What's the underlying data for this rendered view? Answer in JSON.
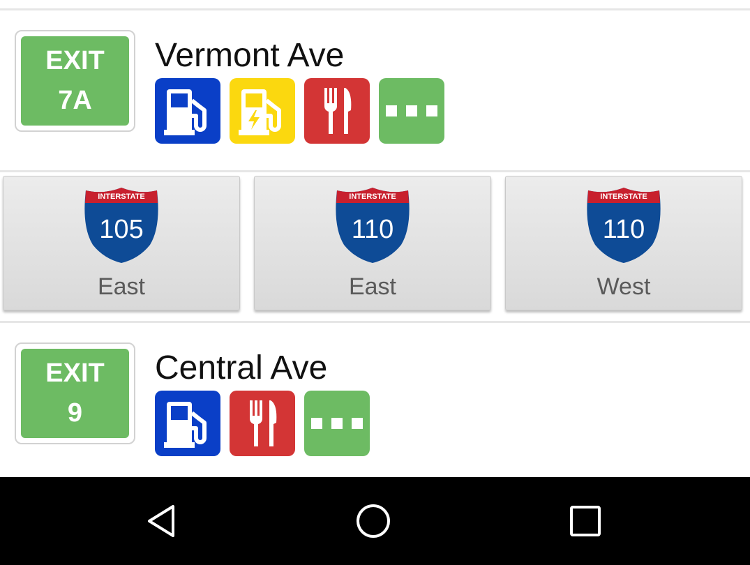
{
  "exits": [
    {
      "exit_label": "EXIT",
      "exit_number": "7A",
      "name": "Vermont Ave",
      "amenities": [
        "gas",
        "ev-charging",
        "food",
        "more"
      ]
    },
    {
      "exit_label": "EXIT",
      "exit_number": "9",
      "name": "Central Ave",
      "amenities": [
        "gas",
        "food",
        "more"
      ]
    }
  ],
  "ramps": [
    {
      "shield_banner": "INTERSTATE",
      "route": "105",
      "direction": "East"
    },
    {
      "shield_banner": "INTERSTATE",
      "route": "110",
      "direction": "East"
    },
    {
      "shield_banner": "INTERSTATE",
      "route": "110",
      "direction": "West"
    }
  ],
  "colors": {
    "exit_green": "#6dbb63",
    "gas_blue": "#0a3fc7",
    "ev_yellow": "#fbd80f",
    "food_red": "#d33535",
    "more_green": "#6dbb63",
    "shield_blue": "#0e4b96",
    "shield_red": "#c8202e"
  },
  "navigation": {
    "icons": [
      "back-triangle-icon",
      "home-circle-icon",
      "recents-square-icon"
    ]
  }
}
